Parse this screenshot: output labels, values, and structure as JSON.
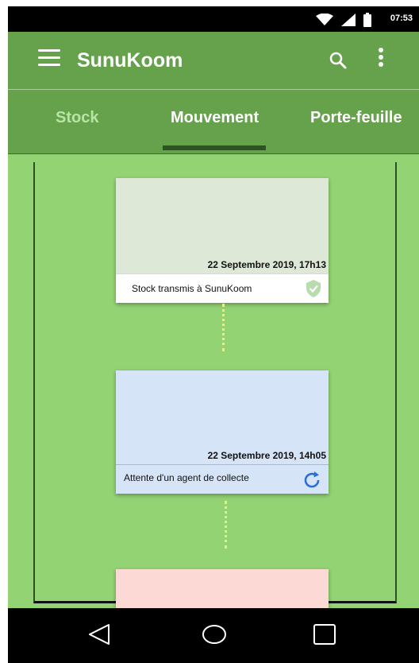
{
  "status_bar": {
    "time": "07:53",
    "icons": [
      "wifi-icon",
      "signal-icon",
      "battery-icon"
    ]
  },
  "app_bar": {
    "title": "SunuKoom",
    "icons": [
      "menu-icon",
      "search-icon",
      "more-vert-icon"
    ]
  },
  "tabs": {
    "items": [
      {
        "label": "Stock"
      },
      {
        "label": "Mouvement"
      },
      {
        "label": "Porte-feuille"
      }
    ],
    "selected": "Mouvement"
  },
  "timeline": [
    {
      "date": "22 Septembre 2019, 17h13",
      "status": "Stock transmis à SunuKoom",
      "icon": "shield-check-icon",
      "color": "#dde8d6"
    },
    {
      "date": "22 Septembre 2019, 14h05",
      "status": "Attente d'un agent de collecte",
      "icon": "refresh-icon",
      "color": "#d6e4f7"
    },
    {
      "color": "#fdd9d6"
    }
  ],
  "colors": {
    "primary": "#66a14c",
    "content_bg": "#94d374",
    "accent_blue": "#2a6fd6"
  },
  "nav_bar": {
    "icons": [
      "back-icon",
      "home-icon",
      "recents-icon"
    ]
  }
}
